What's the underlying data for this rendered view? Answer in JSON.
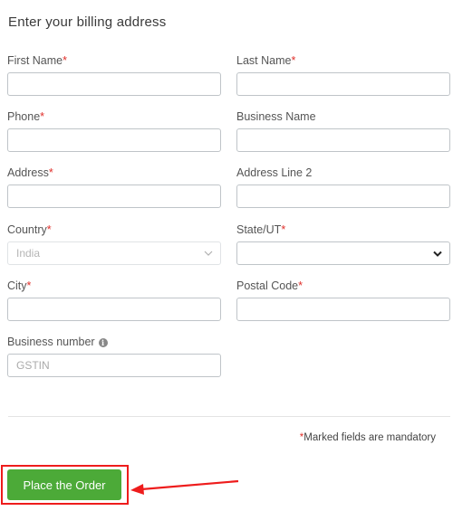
{
  "form": {
    "title": "Enter your billing address",
    "required_marker": "*",
    "fields": {
      "first_name": {
        "label": "First Name",
        "value": ""
      },
      "last_name": {
        "label": "Last Name",
        "value": ""
      },
      "phone": {
        "label": "Phone",
        "value": ""
      },
      "business_name": {
        "label": "Business Name",
        "value": ""
      },
      "address": {
        "label": "Address",
        "value": ""
      },
      "address_line2": {
        "label": "Address Line 2",
        "value": ""
      },
      "country": {
        "label": "Country",
        "value": "India"
      },
      "state": {
        "label": "State/UT",
        "value": ""
      },
      "city": {
        "label": "City",
        "value": ""
      },
      "postal_code": {
        "label": "Postal Code",
        "value": ""
      },
      "business_number": {
        "label": "Business number",
        "placeholder": "GSTIN",
        "info_icon": "info-icon"
      }
    },
    "mandatory_note": "Marked fields are mandatory",
    "submit_label": "Place the Order"
  },
  "colors": {
    "required": "#e0302b",
    "submit_button": "#4caa38",
    "highlight": "#ee1c1c"
  }
}
